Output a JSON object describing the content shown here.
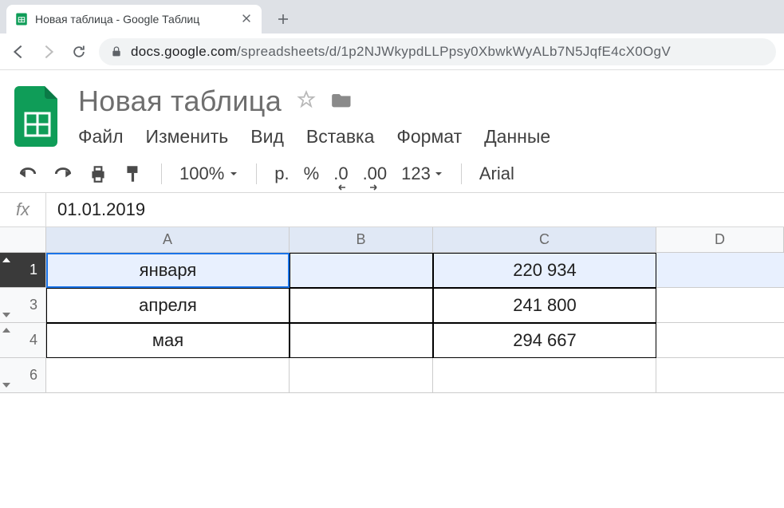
{
  "browser": {
    "tab_title": "Новая таблица - Google Таблиц",
    "url_domain": "docs.google.com",
    "url_path": "/spreadsheets/d/1p2NJWkypdLLPpsy0XbwkWyALb7N5JqfE4cX0OgV"
  },
  "doc": {
    "title": "Новая таблица",
    "menu": {
      "file": "Файл",
      "edit": "Изменить",
      "view": "Вид",
      "insert": "Вставка",
      "format": "Формат",
      "data": "Данные"
    }
  },
  "toolbar": {
    "zoom": "100%",
    "currency": "р.",
    "percent": "%",
    "dec_less": ".0",
    "dec_more": ".00",
    "numfmt": "123",
    "font": "Arial"
  },
  "formula": {
    "fx_label": "fx",
    "value": "01.01.2019"
  },
  "grid": {
    "columns": [
      "A",
      "B",
      "C",
      "D"
    ],
    "rows": [
      {
        "num": "1",
        "a": "января",
        "b": "",
        "c": "220 934",
        "active": true,
        "tri": "up"
      },
      {
        "num": "3",
        "a": "апреля",
        "b": "",
        "c": "241 800",
        "tri": "down"
      },
      {
        "num": "4",
        "a": "мая",
        "b": "",
        "c": "294 667",
        "tri": "up"
      },
      {
        "num": "6",
        "a": "",
        "b": "",
        "c": "",
        "tri": "down",
        "noborder": true
      }
    ]
  }
}
